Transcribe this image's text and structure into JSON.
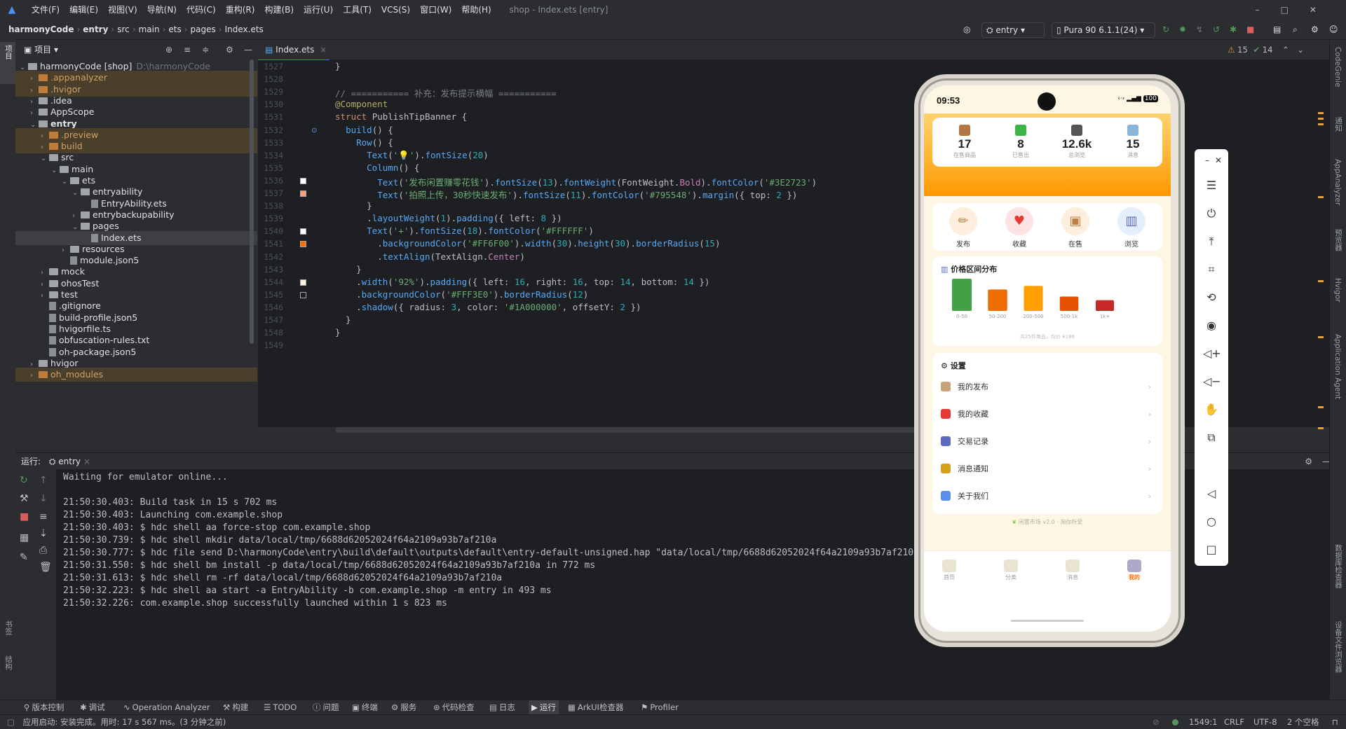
{
  "menu": [
    "文件(F)",
    "编辑(E)",
    "视图(V)",
    "导航(N)",
    "代码(C)",
    "重构(R)",
    "构建(B)",
    "运行(U)",
    "工具(T)",
    "VCS(S)",
    "窗口(W)",
    "帮助(H)"
  ],
  "window_title": "shop - Index.ets [entry]",
  "breadcrumb": [
    "harmonyCode",
    "entry",
    "src",
    "main",
    "ets",
    "pages",
    "Index.ets"
  ],
  "toolbar": {
    "module": "entry",
    "device": "Pura 90 6.1.1(24)"
  },
  "project_panel": {
    "title": "项目",
    "vertical_label": "项目"
  },
  "tree": [
    {
      "label": "harmonyCode [shop]",
      "path": "D:\\harmonyCode",
      "depth": 0,
      "type": "folder",
      "open": true
    },
    {
      "label": ".appanalyzer",
      "depth": 1,
      "type": "folder-or",
      "exc": true
    },
    {
      "label": ".hvigor",
      "depth": 1,
      "type": "folder-or",
      "exc": true
    },
    {
      "label": ".idea",
      "depth": 1,
      "type": "folder"
    },
    {
      "label": "AppScope",
      "depth": 1,
      "type": "folder"
    },
    {
      "label": "entry",
      "depth": 1,
      "type": "folder",
      "open": true,
      "bold": true
    },
    {
      "label": ".preview",
      "depth": 2,
      "type": "folder-or",
      "exc": true
    },
    {
      "label": "build",
      "depth": 2,
      "type": "folder-or",
      "exc": true
    },
    {
      "label": "src",
      "depth": 2,
      "type": "folder",
      "open": true
    },
    {
      "label": "main",
      "depth": 3,
      "type": "folder",
      "open": true
    },
    {
      "label": "ets",
      "depth": 4,
      "type": "folder",
      "open": true
    },
    {
      "label": "entryability",
      "depth": 5,
      "type": "folder",
      "open": true
    },
    {
      "label": "EntryAbility.ets",
      "depth": 6,
      "type": "file"
    },
    {
      "label": "entrybackupability",
      "depth": 5,
      "type": "folder"
    },
    {
      "label": "pages",
      "depth": 5,
      "type": "folder",
      "open": true
    },
    {
      "label": "Index.ets",
      "depth": 6,
      "type": "file",
      "sel": true
    },
    {
      "label": "resources",
      "depth": 4,
      "type": "folder"
    },
    {
      "label": "module.json5",
      "depth": 4,
      "type": "file"
    },
    {
      "label": "mock",
      "depth": 2,
      "type": "folder"
    },
    {
      "label": "ohosTest",
      "depth": 2,
      "type": "folder"
    },
    {
      "label": "test",
      "depth": 2,
      "type": "folder"
    },
    {
      "label": ".gitignore",
      "depth": 2,
      "type": "file"
    },
    {
      "label": "build-profile.json5",
      "depth": 2,
      "type": "file"
    },
    {
      "label": "hvigorfile.ts",
      "depth": 2,
      "type": "file"
    },
    {
      "label": "obfuscation-rules.txt",
      "depth": 2,
      "type": "file"
    },
    {
      "label": "oh-package.json5",
      "depth": 2,
      "type": "file"
    },
    {
      "label": "hvigor",
      "depth": 1,
      "type": "folder"
    },
    {
      "label": "oh_modules",
      "depth": 1,
      "type": "folder-or",
      "exc": true
    }
  ],
  "editor": {
    "tab": "Index.ets",
    "inspections": {
      "warnings": "15",
      "ok": "14"
    },
    "lines": [
      {
        "n": "1527",
        "html": "<span>}</span>"
      },
      {
        "n": "1528",
        "html": ""
      },
      {
        "n": "1529",
        "html": "<span class='cm'>// =========== 补充：发布提示横幅 ===========</span>"
      },
      {
        "n": "1530",
        "html": "<span class='an'>@Component</span>"
      },
      {
        "n": "1531",
        "html": "<span class='kw'>struct</span> <span style='color:#bcbec4'>PublishTipBanner</span> {"
      },
      {
        "n": "1532",
        "html": "  <span class='fn'>build</span>() {"
      },
      {
        "n": "1533",
        "html": "    <span class='fn'>Row</span>() {"
      },
      {
        "n": "1534",
        "html": "      <span class='fn'>Text</span>(<span class='st'>'💡'</span>).<span class='fn'>fontSize</span>(<span class='nm'>20</span>)"
      },
      {
        "n": "1535",
        "html": "      <span class='fn'>Column</span>() {"
      },
      {
        "n": "1536",
        "html": "        <span class='fn'>Text</span>(<span class='st'>'发布闲置赚零花钱'</span>).<span class='fn'>fontSize</span>(<span class='nm'>13</span>).<span class='fn'>fontWeight</span>(FontWeight.<span class='pr'>Bold</span>).<span class='fn'>fontColor</span>(<span class='st'>'#3E2723'</span>)"
      },
      {
        "n": "1537",
        "html": "        <span class='fn'>Text</span>(<span class='st'>'拍照上传，30秒快速发布'</span>).<span class='fn'>fontSize</span>(<span class='nm'>11</span>).<span class='fn'>fontColor</span>(<span class='st'>'#795548'</span>).<span class='fn'>margin</span>({ top: <span class='nm'>2</span> })"
      },
      {
        "n": "1538",
        "html": "      }"
      },
      {
        "n": "1539",
        "html": "      .<span class='fn'>layoutWeight</span>(<span class='nm'>1</span>).<span class='fn'>padding</span>({ left: <span class='nm'>8</span> })"
      },
      {
        "n": "1540",
        "html": "      <span class='fn'>Text</span>(<span class='st'>'+'</span>).<span class='fn'>fontSize</span>(<span class='nm'>18</span>).<span class='fn'>fontColor</span>(<span class='st'>'#FFFFFF'</span>)"
      },
      {
        "n": "1541",
        "html": "        .<span class='fn'>backgroundColor</span>(<span class='st'>'#FF6F00'</span>).<span class='fn'>width</span>(<span class='nm'>30</span>).<span class='fn'>height</span>(<span class='nm'>30</span>).<span class='fn'>borderRadius</span>(<span class='nm'>15</span>)"
      },
      {
        "n": "1542",
        "html": "        .<span class='fn'>textAlign</span>(TextAlign.<span class='pr'>Center</span>)"
      },
      {
        "n": "1543",
        "html": "    }"
      },
      {
        "n": "1544",
        "html": "    .<span class='fn'>width</span>(<span class='st'>'92%'</span>).<span class='fn'>padding</span>({ left: <span class='nm'>16</span>, right: <span class='nm'>16</span>, top: <span class='nm'>14</span>, bottom: <span class='nm'>14</span> })"
      },
      {
        "n": "1545",
        "html": "    .<span class='fn'>backgroundColor</span>(<span class='st'>'#FFF3E0'</span>).<span class='fn'>borderRadius</span>(<span class='nm'>12</span>)"
      },
      {
        "n": "1546",
        "html": "    .<span class='fn'>shadow</span>({ radius: <span class='nm'>3</span>, color: <span class='st'>'#1A000000'</span>, offsetY: <span class='nm'>2</span> })"
      },
      {
        "n": "1547",
        "html": "  }"
      },
      {
        "n": "1548",
        "html": "}"
      },
      {
        "n": "1549",
        "html": ""
      }
    ]
  },
  "run_panel": {
    "label": "运行:",
    "tab": "entry",
    "lines": [
      "Waiting for emulator online...",
      "",
      "21:50:30.403: Build task in 15 s 702 ms",
      "21:50:30.403: Launching com.example.shop",
      "21:50:30.403: $ hdc shell aa force-stop com.example.shop",
      "21:50:30.739: $ hdc shell mkdir data/local/tmp/6688d62052024f64a2109a93b7af210a",
      "21:50:30.777: $ hdc file send D:\\harmonyCode\\entry\\build\\default\\outputs\\default\\entry-default-unsigned.hap \"data/local/tmp/6688d62052024f64a2109a93b7af210a\" in 35 ms",
      "21:50:31.550: $ hdc shell bm install -p data/local/tmp/6688d62052024f64a2109a93b7af210a in 772 ms",
      "21:50:31.613: $ hdc shell rm -rf data/local/tmp/6688d62052024f64a2109a93b7af210a",
      "21:50:32.223: $ hdc shell aa start -a EntryAbility -b com.example.shop -m entry in 493 ms",
      "21:50:32.226: com.example.shop successfully launched within 1 s 823 ms"
    ]
  },
  "bottom_tools": [
    "版本控制",
    "调试",
    "Operation Analyzer",
    "构建",
    "TODO",
    "问题",
    "终端",
    "服务",
    "代码检查",
    "日志",
    "运行",
    "ArkUI检查器",
    "Profiler"
  ],
  "status": {
    "message": "应用启动: 安装完成。用时: 17 s 567 ms。(3 分钟之前)",
    "position": "1549:1",
    "line_sep": "CRLF",
    "encoding": "UTF-8",
    "indent": "2 个空格"
  },
  "right_strip": [
    "CodeGenie",
    "通知",
    "AppAnalyzer",
    "预览器",
    "Hvigor",
    "Application Agent",
    "数据库检查器",
    "设备文件浏览器"
  ],
  "left_strip": [
    "项目",
    "书签",
    "结构"
  ],
  "phone": {
    "time": "09:53",
    "battery": "100",
    "stats": [
      {
        "num": "17",
        "label": "在售商品",
        "color": "#b07840"
      },
      {
        "num": "8",
        "label": "已售出",
        "color": "#3bb54a"
      },
      {
        "num": "12.6k",
        "label": "总浏览",
        "color": "#555555"
      },
      {
        "num": "15",
        "label": "消息",
        "color": "#8ab4d8"
      }
    ],
    "quick_actions": [
      {
        "label": "发布",
        "icon": "✏",
        "bg": "#fdeedd"
      },
      {
        "label": "收藏",
        "icon": "♥",
        "bg": "#fde3e3"
      },
      {
        "label": "在售",
        "icon": "▣",
        "bg": "#fdeedd"
      },
      {
        "label": "浏览",
        "icon": "▥",
        "bg": "#e5eefb"
      }
    ],
    "price_chart": {
      "title": "价格区间分布",
      "footer": "共25件商品，均价 ¥186"
    },
    "settings": {
      "title": "设置",
      "items": [
        {
          "label": "我的发布",
          "color": "#c9a37a"
        },
        {
          "label": "我的收藏",
          "color": "#e53935"
        },
        {
          "label": "交易记录",
          "color": "#5c6bc0"
        },
        {
          "label": "消息通知",
          "color": "#d4a017"
        },
        {
          "label": "关于我们",
          "color": "#5b8def"
        }
      ]
    },
    "version": "闲置市场 v2.0 · 淘你所爱",
    "tabs": [
      {
        "label": "首页",
        "active": false
      },
      {
        "label": "分类",
        "active": false
      },
      {
        "label": "消息",
        "active": false
      },
      {
        "label": "我的",
        "active": true
      }
    ]
  },
  "chart_data": {
    "type": "bar",
    "title": "价格区间分布",
    "categories": [
      "0-50",
      "50-200",
      "200-500",
      "500-1k",
      "1k+"
    ],
    "values": [
      9,
      6,
      7,
      4,
      3
    ],
    "colors": [
      "#43a047",
      "#ef6c00",
      "#ffa000",
      "#e65100",
      "#c62828"
    ]
  },
  "colors": {
    "accent": "#3574f0",
    "editor_bg": "#1e1f22",
    "panel_bg": "#2b2d30",
    "phone_orange": "#ffa000"
  }
}
